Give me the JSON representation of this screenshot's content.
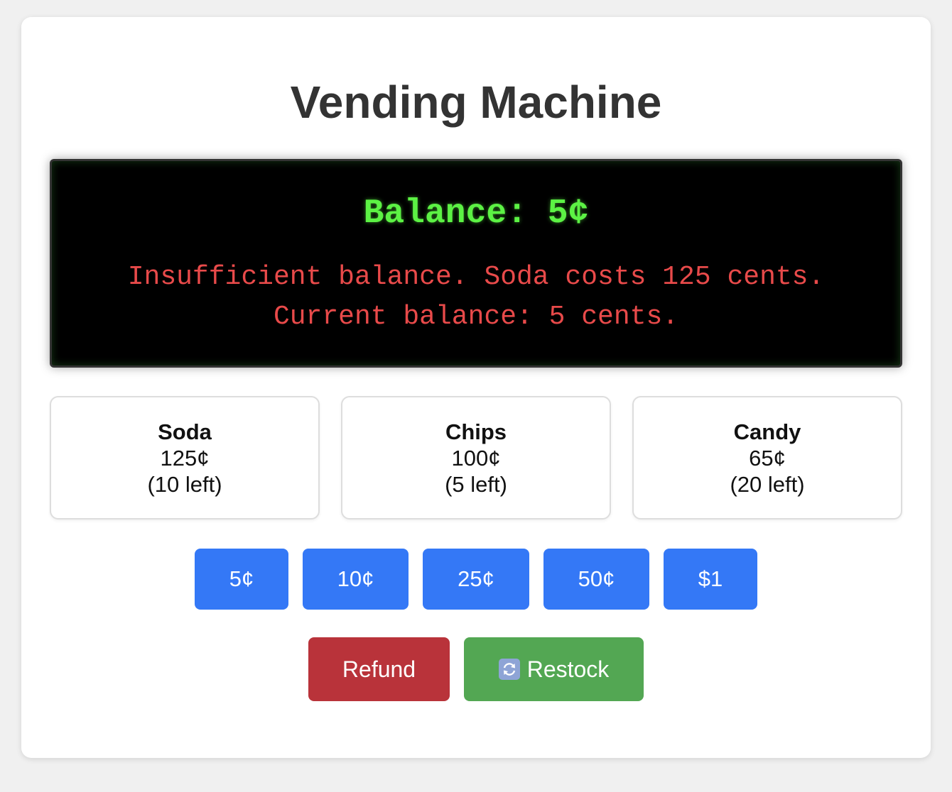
{
  "title": "Vending Machine",
  "display": {
    "balance": "Balance: 5¢",
    "message": "Insufficient balance. Soda costs 125 cents. Current balance: 5 cents."
  },
  "products": [
    {
      "name": "Soda",
      "price": "125¢",
      "stock": "(10 left)"
    },
    {
      "name": "Chips",
      "price": "100¢",
      "stock": "(5 left)"
    },
    {
      "name": "Candy",
      "price": "65¢",
      "stock": "(20 left)"
    }
  ],
  "coins": [
    "5¢",
    "10¢",
    "25¢",
    "50¢",
    "$1"
  ],
  "actions": {
    "refund": "Refund",
    "restock": "Restock",
    "restock_icon": "refresh-icon"
  },
  "colors": {
    "coin_button": "#3478f6",
    "refund_button": "#b9333a",
    "restock_button": "#53a753",
    "balance_text": "#5cf244",
    "message_text": "#e84a4a"
  }
}
